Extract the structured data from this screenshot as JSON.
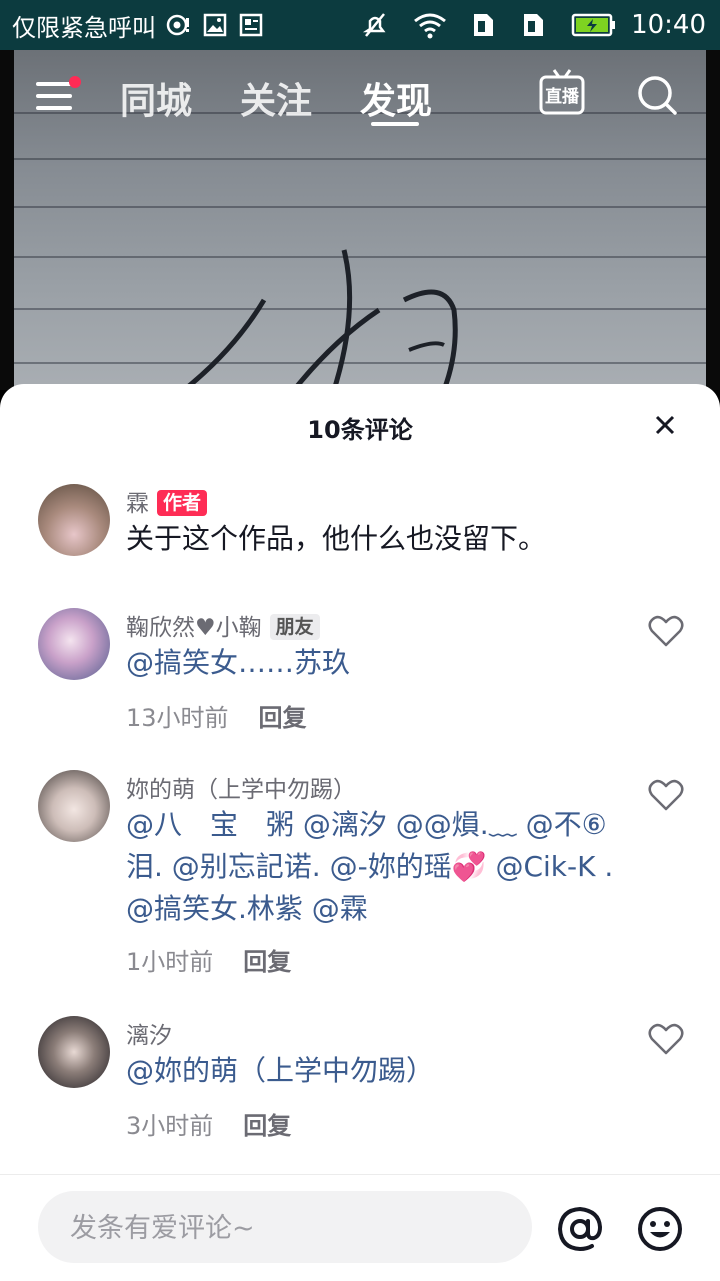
{
  "status_bar": {
    "carrier": "仅限紧急呼叫",
    "time": "10:40",
    "icons": [
      "nfc-icon",
      "image-icon",
      "news-icon",
      "mute-icon",
      "wifi-icon",
      "sim1-icon",
      "sim2-icon",
      "battery-charging-icon"
    ]
  },
  "top_nav": {
    "tabs": [
      "同城",
      "关注",
      "发现"
    ],
    "active_tab": "发现",
    "live_label": "直播"
  },
  "comments_sheet": {
    "title": "10条评论",
    "comments": [
      {
        "name": "霖",
        "badge": "作者",
        "text": "关于这个作品，他什么也没留下。"
      },
      {
        "name": "鞠欣然♥小鞠",
        "badge": "朋友",
        "text": "@搞笑女……苏玖",
        "time": "13小时前",
        "reply": "回复"
      },
      {
        "name": "妳的萌（上学中勿踢）",
        "text": "@八　宝　粥 @漓汐 @@熉.﹏ @不⑥泪. @别忘記诺. @-妳的瑶💞 @Cik-K . @搞笑女.林紫 @霖",
        "time": "1小时前",
        "reply": "回复"
      },
      {
        "name": "漓汐",
        "text": "@妳的萌（上学中勿踢）",
        "time": "3小时前",
        "reply": "回复"
      }
    ]
  },
  "input": {
    "placeholder": "发条有爱评论~"
  },
  "colors": {
    "status_bar": "#0c3b3f",
    "author_badge": "#fe2c55",
    "mention": "#3b5b8e"
  }
}
